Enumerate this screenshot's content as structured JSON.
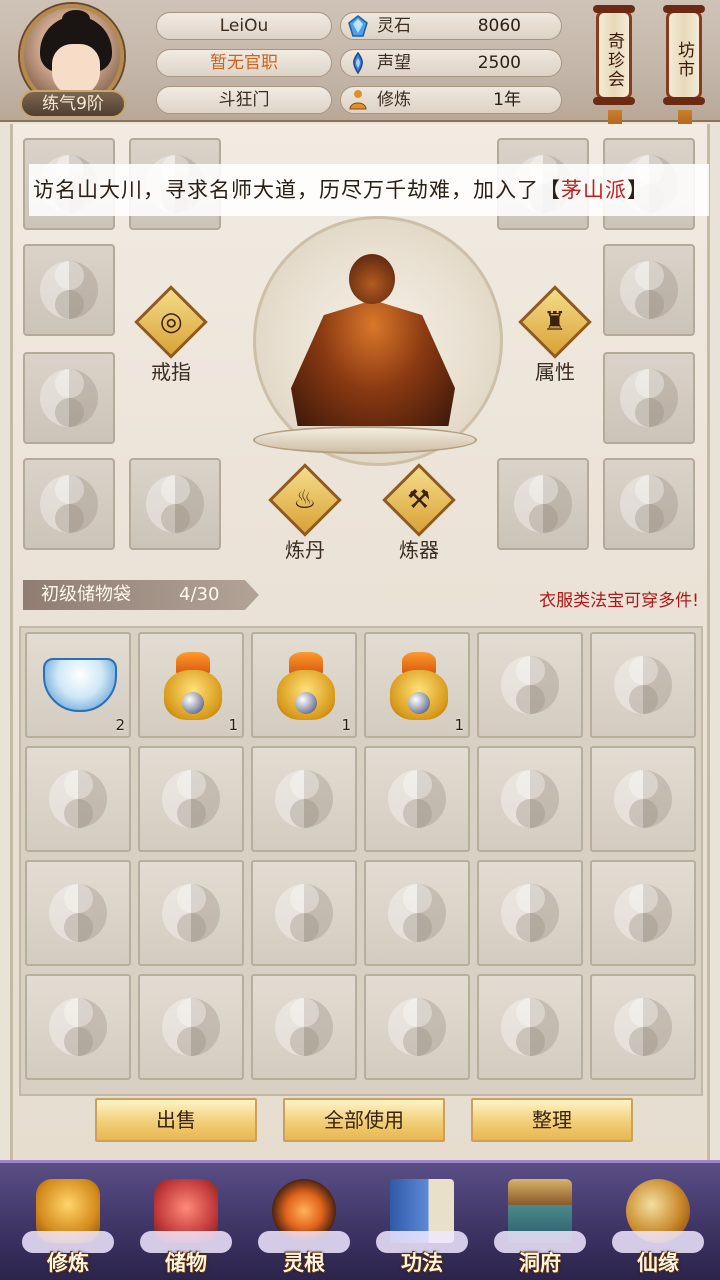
{
  "player": {
    "name": "LeiOu",
    "official_rank": "暂无官职",
    "sect_name": "斗狂门",
    "level": "练气9阶"
  },
  "resources": [
    {
      "icon": "spirit-stone-icon",
      "label": "灵石",
      "value": "8060"
    },
    {
      "icon": "reputation-icon",
      "label": "声望",
      "value": "2500"
    },
    {
      "icon": "cultivation-icon",
      "label": "修炼",
      "value": "1年"
    }
  ],
  "top_buttons": {
    "treasure_hall": "奇珍会",
    "market": "坊市"
  },
  "banner": {
    "text": "访名山大川，寻求名师大道，历尽万千劫难，加入了【",
    "sect": "茅山派",
    "suffix": "】"
  },
  "functions": {
    "ring": "戒指",
    "attributes": "属性",
    "alchemy": "炼丹",
    "forging": "炼器"
  },
  "bag": {
    "name": "初级储物袋",
    "count": "4/30",
    "hint": "衣服类法宝可穿多件!",
    "items": [
      {
        "icon": "tea-bowl-icon",
        "qty": "2"
      },
      {
        "icon": "gold-pouch-icon",
        "qty": "1"
      },
      {
        "icon": "gold-pouch-icon",
        "qty": "1"
      },
      {
        "icon": "gold-pouch-icon",
        "qty": "1"
      }
    ]
  },
  "actions": {
    "sell": "出售",
    "use_all": "全部使用",
    "sort": "整理"
  },
  "nav": [
    {
      "icon": "cultivate-icon",
      "label": "修炼"
    },
    {
      "icon": "storage-icon",
      "label": "储物"
    },
    {
      "icon": "spirit-root-icon",
      "label": "灵根"
    },
    {
      "icon": "technique-icon",
      "label": "功法"
    },
    {
      "icon": "cave-icon",
      "label": "洞府"
    },
    {
      "icon": "fortune-icon",
      "label": "仙缘"
    }
  ],
  "colors": {
    "accent_gold": "#f1cf78",
    "sect_red": "#c21f1f",
    "official_orange": "#d0621b",
    "hint_red": "#b41616",
    "nav_purple": "#3c3363"
  }
}
